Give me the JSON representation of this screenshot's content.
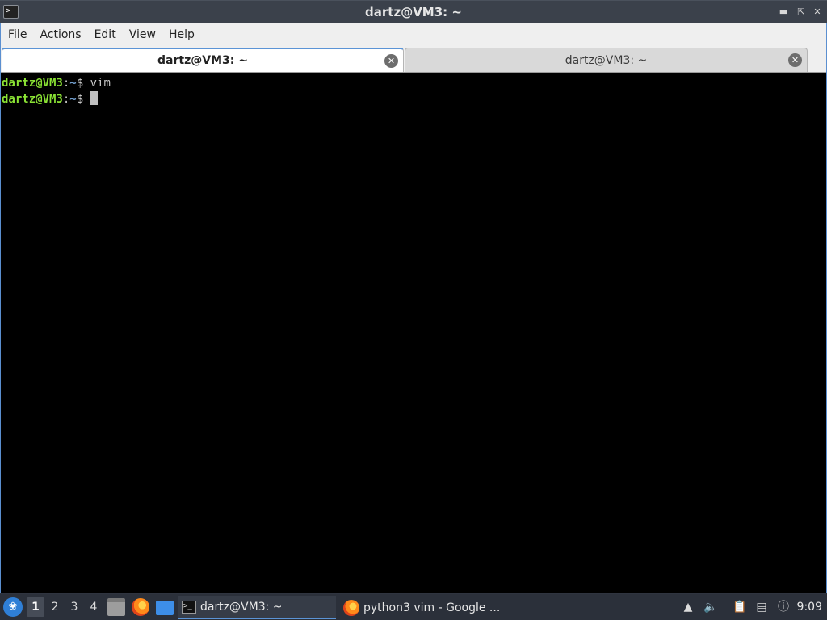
{
  "window": {
    "title": "dartz@VM3: ~",
    "icon": "terminal-icon",
    "controls": [
      "minimize-icon",
      "maximize-icon",
      "close-icon"
    ]
  },
  "menubar": {
    "items": [
      "File",
      "Actions",
      "Edit",
      "View",
      "Help"
    ]
  },
  "tabs": [
    {
      "label": "dartz@VM3: ~",
      "active": true
    },
    {
      "label": "dartz@VM3: ~",
      "active": false
    }
  ],
  "terminal": {
    "lines": [
      {
        "user": "dartz@VM3",
        "colon": ":",
        "path": "~",
        "symbol": "$ ",
        "command": "vim"
      },
      {
        "user": "dartz@VM3",
        "colon": ":",
        "path": "~",
        "symbol": "$ ",
        "command": ""
      }
    ],
    "colors": {
      "user": "#8ae234",
      "path": "#729fcf",
      "background": "#000000"
    }
  },
  "taskbar": {
    "desktops": [
      "1",
      "2",
      "3",
      "4"
    ],
    "current_desktop": "1",
    "launchers": [
      "file-manager-icon",
      "firefox-icon",
      "show-desktop-icon"
    ],
    "tasks": [
      {
        "label": "dartz@VM3: ~",
        "icon": "terminal-icon",
        "active": true
      },
      {
        "label": "python3 vim - Google ...",
        "icon": "firefox-icon",
        "active": false
      }
    ],
    "tray": [
      "updates-icon",
      "volume-icon",
      "clipboard-icon",
      "network-icon",
      "notification-icon"
    ],
    "clock": "9:09"
  }
}
